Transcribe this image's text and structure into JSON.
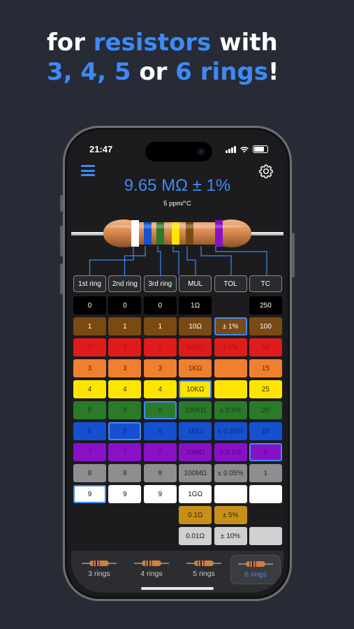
{
  "headline": {
    "line1_pre": "for ",
    "line1_hl": "resistors",
    "line1_post": " with",
    "line2_hl1": "3, 4, 5",
    "line2_mid": " or ",
    "line2_hl2": "6 rings",
    "line2_post": "!"
  },
  "status_bar": {
    "time": "21:47"
  },
  "toolbar": {
    "menu_icon": "hamburger-menu-icon",
    "settings_icon": "gear-icon"
  },
  "result": {
    "value": "9.65 MΩ ± 1%",
    "tc": "5 ppm/°C"
  },
  "columns": [
    "1st ring",
    "2nd ring",
    "3rd ring",
    "MUL",
    "TOL",
    "TC"
  ],
  "rows": [
    {
      "color": "#000000",
      "text": "#ffffff",
      "cells": [
        "0",
        "0",
        "0",
        "1Ω",
        "",
        "250"
      ]
    },
    {
      "color": "#7a4a14",
      "text": "#ffffff",
      "cells": [
        "1",
        "1",
        "1",
        "10Ω",
        "± 1%",
        "100"
      ]
    },
    {
      "color": "#e01b1b",
      "text": "#b01010",
      "cells": [
        "2",
        "2",
        "2",
        "100Ω",
        "± 2%",
        "50"
      ]
    },
    {
      "color": "#f08030",
      "text": "#5a2a08",
      "cells": [
        "3",
        "3",
        "3",
        "1KΩ",
        "",
        "15"
      ]
    },
    {
      "color": "#fde500",
      "text": "#3a3000",
      "cells": [
        "4",
        "4",
        "4",
        "10KΩ",
        "",
        "25"
      ]
    },
    {
      "color": "#2a7a2a",
      "text": "#123f12",
      "cells": [
        "5",
        "5",
        "5",
        "100KΩ",
        "± 0.5%",
        "20"
      ]
    },
    {
      "color": "#1550d0",
      "text": "#0c2d78",
      "cells": [
        "6",
        "6",
        "6",
        "1MΩ",
        "± 0.25%",
        "10"
      ]
    },
    {
      "color": "#8a10c8",
      "text": "#4a0870",
      "cells": [
        "7",
        "7",
        "7",
        "10MΩ",
        "± 0.1%",
        "5"
      ]
    },
    {
      "color": "#8e8e90",
      "text": "#2a2a2c",
      "cells": [
        "8",
        "8",
        "8",
        "100MΩ",
        "± 0.05%",
        "1"
      ]
    },
    {
      "color": "#ffffff",
      "text": "#111111",
      "cells": [
        "9",
        "9",
        "9",
        "1GΩ",
        "",
        ""
      ]
    },
    {
      "color": "#c89018",
      "text": "#3a2800",
      "cells": [
        "",
        "",
        "",
        "0.1Ω",
        "± 5%",
        ""
      ]
    },
    {
      "color": "#d0d0d2",
      "text": "#222222",
      "cells": [
        "",
        "",
        "",
        "0.01Ω",
        "± 10%",
        ""
      ]
    }
  ],
  "selected": [
    [
      9,
      0
    ],
    [
      6,
      1
    ],
    [
      5,
      2
    ],
    [
      4,
      3
    ],
    [
      1,
      4
    ],
    [
      7,
      5
    ]
  ],
  "resistor_bands": [
    "#ffffff",
    "#1550d0",
    "#2a7a2a",
    "#fde500",
    "#7a4a14",
    "#8a10c8"
  ],
  "tabs": [
    {
      "label": "3 rings",
      "active": false
    },
    {
      "label": "4 rings",
      "active": false
    },
    {
      "label": "5 rings",
      "active": false
    },
    {
      "label": "6 rings",
      "active": true
    }
  ],
  "accent_color": "#3d8af7"
}
